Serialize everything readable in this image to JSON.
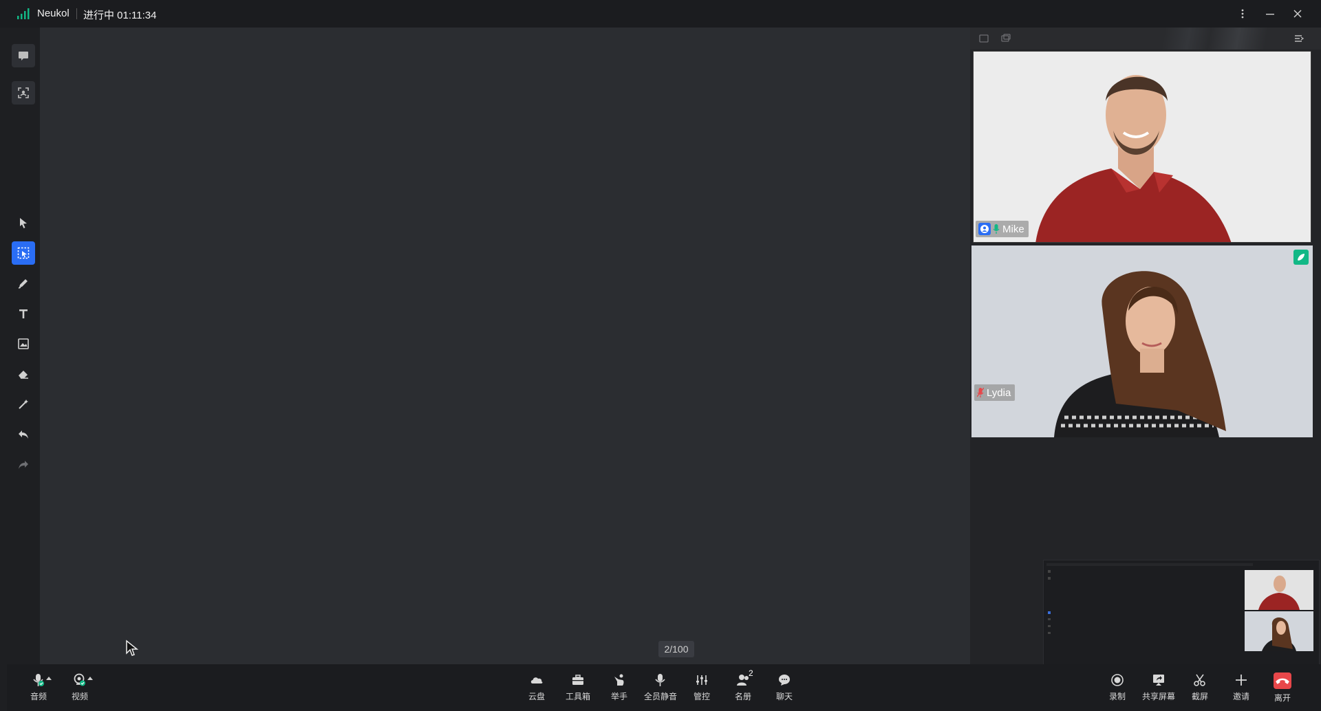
{
  "titlebar": {
    "app_name": "Neukol",
    "status": "进行中 01:11:34",
    "icons": [
      "signal-icon",
      "more-icon",
      "minimize-icon",
      "close-icon"
    ]
  },
  "left_toolbar": {
    "top_tools": [
      "chat-screen-icon",
      "face-frame-icon"
    ],
    "tools": [
      "select-icon",
      "region-select-icon",
      "pen-icon",
      "text-icon",
      "image-icon",
      "eraser-icon",
      "magic-wand-icon",
      "undo-icon",
      "redo-icon"
    ],
    "active_tool": "region-select-icon"
  },
  "whiteboard": {
    "page_counter": "2/100"
  },
  "participants": [
    {
      "name": "Mike",
      "role_icon": "host-avatar-icon",
      "mic": "mic-on-icon"
    },
    {
      "name": "Lydia",
      "mic": "mic-muted-icon",
      "badge": "speaking-icon"
    }
  ],
  "bottom_bar": {
    "left": [
      {
        "label": "音频",
        "icon": "mic-icon"
      },
      {
        "label": "视频",
        "icon": "camera-icon"
      }
    ],
    "center": [
      {
        "label": "云盘",
        "icon": "cloud-icon"
      },
      {
        "label": "工具箱",
        "icon": "toolbox-icon"
      },
      {
        "label": "举手",
        "icon": "raise-hand-icon"
      },
      {
        "label": "全员静音",
        "icon": "mute-all-icon"
      },
      {
        "label": "管控",
        "icon": "controls-icon"
      },
      {
        "label": "名册",
        "icon": "roster-icon",
        "count": "2"
      },
      {
        "label": "聊天",
        "icon": "chat-icon"
      }
    ],
    "right": [
      {
        "label": "录制",
        "icon": "record-icon"
      },
      {
        "label": "共享屏幕",
        "icon": "share-screen-icon"
      },
      {
        "label": "截屏",
        "icon": "screenshot-icon"
      },
      {
        "label": "邀请",
        "icon": "invite-icon"
      },
      {
        "label": "离开",
        "icon": "leave-icon"
      }
    ]
  },
  "colors": {
    "accent": "#2a6df4",
    "speaking": "#12b886",
    "leave": "#e8474a",
    "muted": "#e8474a"
  }
}
